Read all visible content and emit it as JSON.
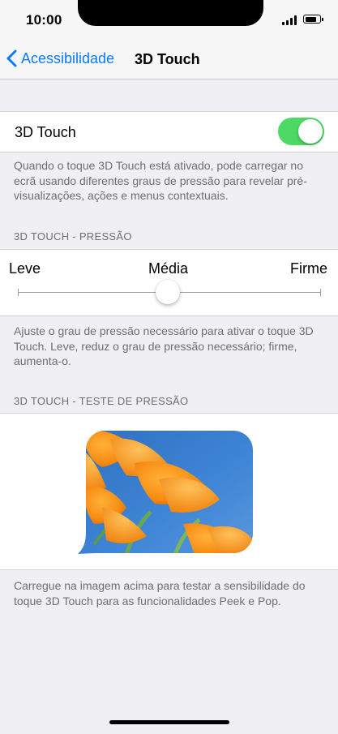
{
  "status_bar": {
    "time": "10:00",
    "icons": [
      "signal-icon",
      "battery-icon"
    ],
    "battery_level": 0.85
  },
  "nav": {
    "back_label": "Acessibilidade",
    "title": "3D Touch",
    "accent_color": "#0a7aff"
  },
  "toggle_row": {
    "label": "3D Touch",
    "on": true,
    "on_color": "#4cd964"
  },
  "toggle_footer": "Quando o toque 3D Touch está ativado, pode carregar no ecrã usando diferentes graus de pressão para revelar pré-visualizações, ações e menus contextuais.",
  "pressure": {
    "header": "3D TOUCH - PRESSÃO",
    "labels": {
      "low": "Leve",
      "mid": "Média",
      "high": "Firme"
    },
    "value": 0.5,
    "footer": "Ajuste o grau de pressão necessário para ativar o toque 3D Touch. Leve, reduz o grau de pressão necessário; firme, aumenta-o."
  },
  "test": {
    "header": "3D TOUCH - TESTE DE PRESSÃO",
    "image_icon": "flower-photo",
    "footer": "Carregue na imagem acima para testar a sensibilidade do toque 3D Touch para as funcionalidades Peek e Pop."
  }
}
